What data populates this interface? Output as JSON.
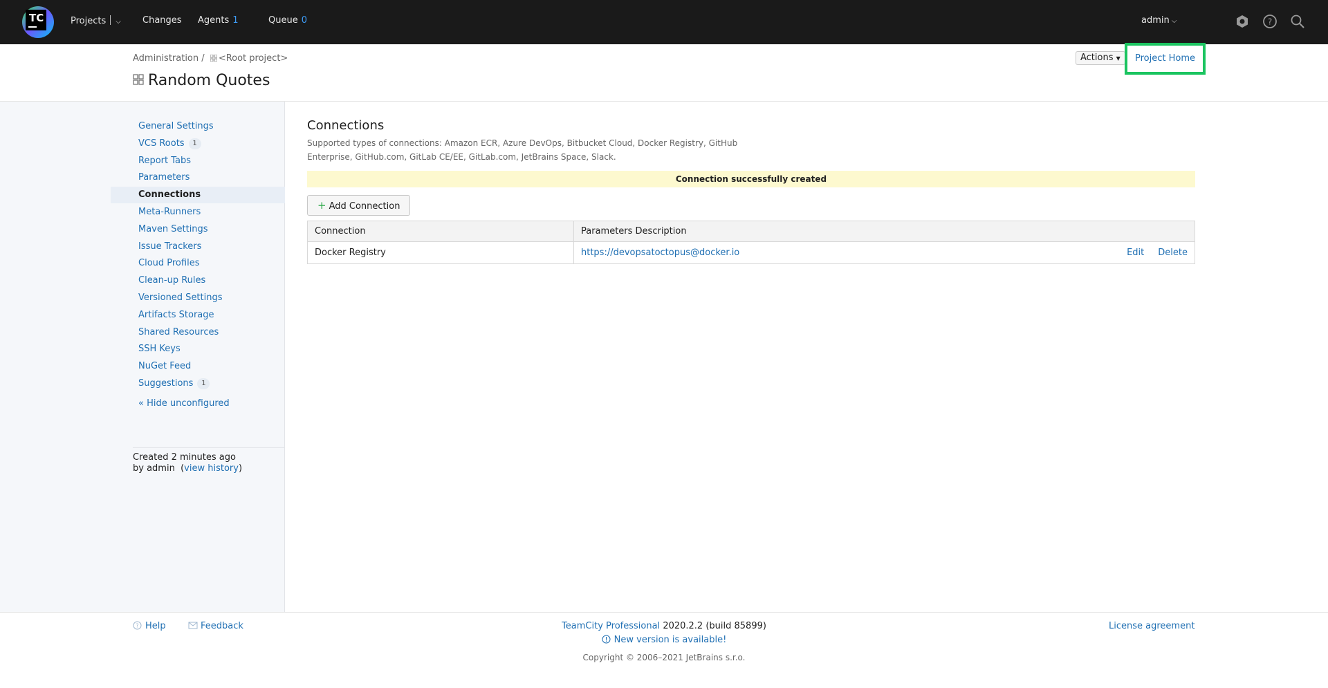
{
  "topbar": {
    "logo_text": "TC",
    "projects_label": "Projects",
    "changes_label": "Changes",
    "agents_label": "Agents",
    "agents_count": "1",
    "queue_label": "Queue",
    "queue_count": "0",
    "user_label": "admin"
  },
  "header": {
    "breadcrumb_admin": "Administration",
    "breadcrumb_sep": "/",
    "breadcrumb_root": "<Root project>",
    "title": "Random Quotes",
    "actions_label": "Actions",
    "project_home_label": "Project Home"
  },
  "sidebar": {
    "items": [
      {
        "label": "General Settings",
        "badge": ""
      },
      {
        "label": "VCS Roots",
        "badge": "1"
      },
      {
        "label": "Report Tabs",
        "badge": ""
      },
      {
        "label": "Parameters",
        "badge": ""
      },
      {
        "label": "Connections",
        "badge": ""
      },
      {
        "label": "Meta-Runners",
        "badge": ""
      },
      {
        "label": "Maven Settings",
        "badge": ""
      },
      {
        "label": "Issue Trackers",
        "badge": ""
      },
      {
        "label": "Cloud Profiles",
        "badge": ""
      },
      {
        "label": "Clean-up Rules",
        "badge": ""
      },
      {
        "label": "Versioned Settings",
        "badge": ""
      },
      {
        "label": "Artifacts Storage",
        "badge": ""
      },
      {
        "label": "Shared Resources",
        "badge": ""
      },
      {
        "label": "SSH Keys",
        "badge": ""
      },
      {
        "label": "NuGet Feed",
        "badge": ""
      },
      {
        "label": "Suggestions",
        "badge": "1"
      }
    ],
    "active_item": "Connections",
    "hide_unconfigured": "« Hide unconfigured",
    "created_line": "Created 2 minutes ago",
    "by_line": "by admin",
    "view_history_open": "(",
    "view_history": "view history",
    "view_history_close": ")"
  },
  "main": {
    "title": "Connections",
    "description": "Supported types of connections: Amazon ECR, Azure DevOps, Bitbucket Cloud, Docker Registry, GitHub Enterprise, GitHub.com, GitLab CE/EE, GitLab.com, JetBrains Space, Slack.",
    "message": "Connection successfully created",
    "add_button": "Add Connection",
    "table": {
      "headers": [
        "Connection",
        "Parameters Description"
      ],
      "rows": [
        {
          "connection": "Docker Registry",
          "params": "https://devopsatoctopus@docker.io",
          "edit": "Edit",
          "delete": "Delete"
        }
      ]
    }
  },
  "footer": {
    "help": "Help",
    "feedback": "Feedback",
    "product": "TeamCity Professional",
    "version": "2020.2.2 (build 85899)",
    "new_version": "New version is available!",
    "license": "License agreement",
    "copyright": "Copyright © 2006–2021 JetBrains s.r.o."
  },
  "colors": {
    "topbar_bg": "#1a1a1a",
    "link": "#1f6fb3",
    "highlight": "#1bc460",
    "message_bg": "#fdf9cf",
    "sidebar_bg": "#f5f7fa"
  }
}
